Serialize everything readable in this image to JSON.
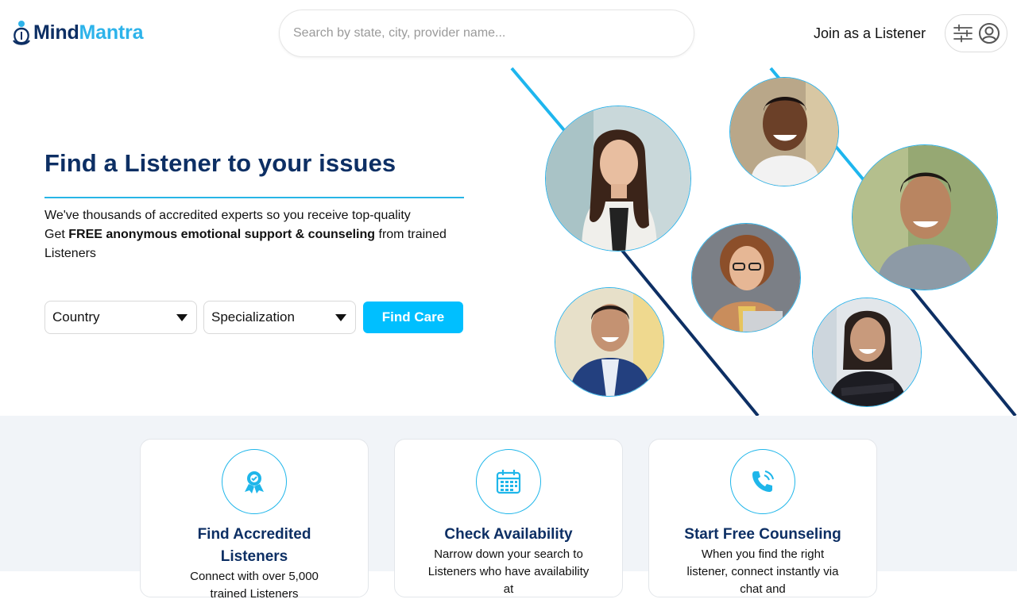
{
  "header": {
    "logo_part1": "Mind",
    "logo_part2": "Mantra",
    "search_placeholder": "Search by state, city, provider name...",
    "join_label": "Join as a Listener",
    "menu_icon": "sliders-icon",
    "user_icon": "user-circle-icon"
  },
  "hero": {
    "title": "Find a Listener to your issues",
    "line1": "We've thousands of accredited experts so you receive top-quality",
    "line2_pre": "Get ",
    "line2_bold": "FREE anonymous emotional support & counseling",
    "line2_post": " from trained Listeners",
    "country_label": "Country",
    "specialization_label": "Specialization",
    "cta_label": "Find Care"
  },
  "colors": {
    "navy": "#0d2f64",
    "accent": "#00bfff",
    "light_blue": "#2db3ea"
  },
  "features": [
    {
      "icon": "award-ribbon-icon",
      "title": "Find Accredited Listeners",
      "desc": "Connect with over 5,000 trained Listeners"
    },
    {
      "icon": "calendar-icon",
      "title": "Check Availability",
      "desc": "Narrow down your search to Listeners who have availability at"
    },
    {
      "icon": "phone-call-icon",
      "title": "Start Free Counseling",
      "desc": "When you find the right listener, connect instantly via chat and"
    }
  ]
}
